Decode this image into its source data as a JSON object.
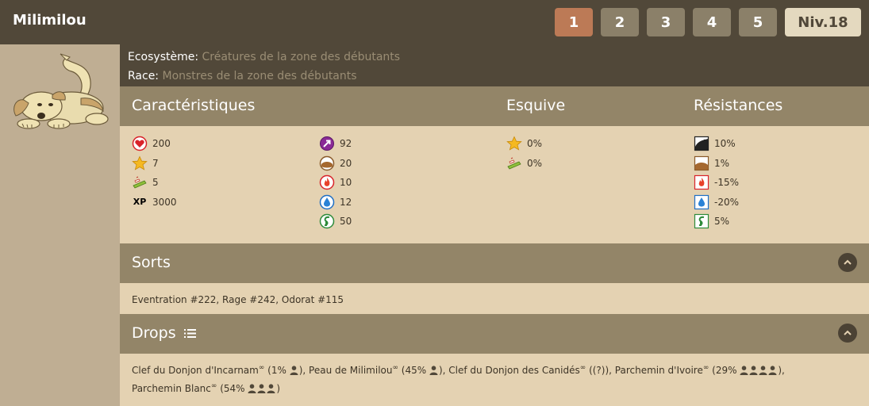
{
  "monster": {
    "name": "Milimilou",
    "level_label": "Niv.18"
  },
  "grades": [
    {
      "label": "1",
      "active": true
    },
    {
      "label": "2",
      "active": false
    },
    {
      "label": "3",
      "active": false
    },
    {
      "label": "4",
      "active": false
    },
    {
      "label": "5",
      "active": false
    }
  ],
  "info": {
    "ecosystem_label": "Ecosystème:",
    "ecosystem_value": "Créatures de la zone des débutants",
    "race_label": "Race:",
    "race_value": "Monstres de la zone des débutants"
  },
  "sections": {
    "characteristics": "Caractéristiques",
    "dodge": "Esquive",
    "resistances": "Résistances",
    "spells": "Sorts",
    "drops": "Drops"
  },
  "characteristics_col1": [
    {
      "icon": "heart-icon",
      "value": "200"
    },
    {
      "icon": "star-icon",
      "value": "7"
    },
    {
      "icon": "boot-icon",
      "value": "5"
    },
    {
      "icon": "xp-icon",
      "value": "3000"
    }
  ],
  "characteristics_col2": [
    {
      "icon": "power-arrow-icon",
      "value": "92"
    },
    {
      "icon": "earth-icon",
      "value": "20"
    },
    {
      "icon": "fire-icon",
      "value": "10"
    },
    {
      "icon": "water-icon",
      "value": "12"
    },
    {
      "icon": "air-icon",
      "value": "50"
    }
  ],
  "dodge": [
    {
      "icon": "star-icon",
      "value": "0%"
    },
    {
      "icon": "boot-icon",
      "value": "0%"
    }
  ],
  "resistances": [
    {
      "icon": "neutral-resist-icon",
      "value": "10%"
    },
    {
      "icon": "earth-resist-icon",
      "value": "1%"
    },
    {
      "icon": "fire-resist-icon",
      "value": "-15%"
    },
    {
      "icon": "water-resist-icon",
      "value": "-20%"
    },
    {
      "icon": "air-resist-icon",
      "value": "5%"
    }
  ],
  "spells_text": "Eventration #222, Rage #242, Odorat #115",
  "drops": [
    {
      "name": "Clef du Donjon d'Incarnam",
      "chance": "1%",
      "players": 1,
      "sep": ", "
    },
    {
      "name": "Peau de Milimilou",
      "chance": "45%",
      "players": 1,
      "sep": ", "
    },
    {
      "name": "Clef du Donjon des Canidés",
      "chance": "(?)",
      "players": 0,
      "sep": ", "
    },
    {
      "name": "Parchemin d'Ivoire",
      "chance": "29%",
      "players": 4,
      "sep": ", "
    },
    {
      "name": "Parchemin Blanc",
      "chance": "54%",
      "players": 3,
      "sep": ""
    }
  ],
  "colors": {
    "header_dark": "#514839",
    "section_header": "#938568",
    "panel_bg": "#e4d2b2",
    "active_tab": "#bc7a56",
    "tab": "#8b8069"
  }
}
